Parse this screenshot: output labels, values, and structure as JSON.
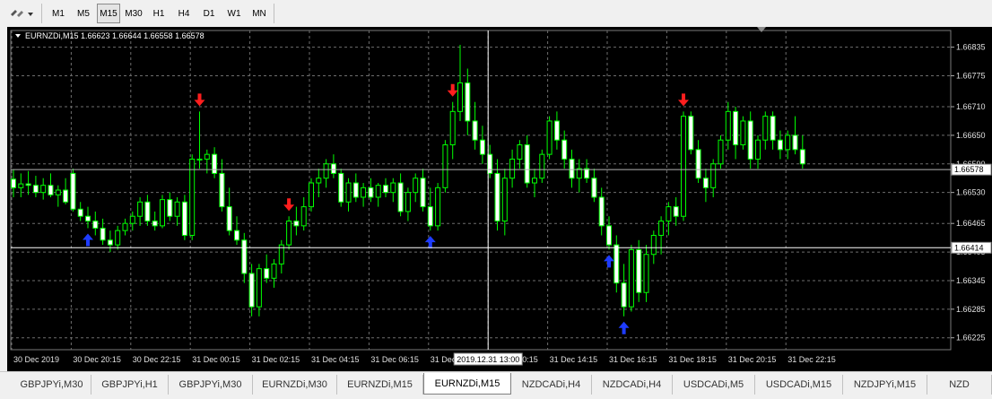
{
  "toolbar": {
    "timeframes": [
      {
        "label": "M1",
        "active": false
      },
      {
        "label": "M5",
        "active": false
      },
      {
        "label": "M15",
        "active": true
      },
      {
        "label": "M30",
        "active": false
      },
      {
        "label": "H1",
        "active": false
      },
      {
        "label": "H4",
        "active": false
      },
      {
        "label": "D1",
        "active": false
      },
      {
        "label": "W1",
        "active": false
      },
      {
        "label": "MN",
        "active": false
      }
    ]
  },
  "chart": {
    "header": "EURNZDi,M15  1.66623 1.66644 1.66558 1.66578",
    "current_price_label": "1.66578",
    "crosshair_price_label": "1.66414",
    "crosshair_time_label": "2019.12.31 13:00",
    "colors": {
      "background": "#000000",
      "up": "#00ff00",
      "down": "#00ff00",
      "body_up": "#000000",
      "body_down": "#ffffff",
      "grid": "#6e6e6e",
      "signal_up": "#1e3cff",
      "signal_down": "#ff1e1e"
    }
  },
  "chart_data": {
    "type": "candlestick",
    "y_ticks": [
      "1.66835",
      "1.66775",
      "1.66710",
      "1.66650",
      "1.66590",
      "1.66530",
      "1.66465",
      "1.66405",
      "1.66345",
      "1.66285",
      "1.66225"
    ],
    "ylim": [
      1.662,
      1.6687
    ],
    "x_ticks": [
      "30 Dec 2019",
      "30 Dec 20:15",
      "30 Dec 22:15",
      "31 Dec 00:15",
      "31 Dec 02:15",
      "31 Dec 04:15",
      "31 Dec 06:15",
      "31 Dec 08:15",
      "31 Dec 10:15",
      "31 Dec 14:15",
      "31 Dec 16:15",
      "31 Dec 18:15",
      "31 Dec 20:15",
      "31 Dec 22:15"
    ],
    "candles": [
      [
        1.66558,
        1.66578,
        1.6652,
        1.6654
      ],
      [
        1.6654,
        1.6657,
        1.6652,
        1.66548
      ],
      [
        1.66548,
        1.66575,
        1.66525,
        1.66545
      ],
      [
        1.66545,
        1.66565,
        1.6652,
        1.6653
      ],
      [
        1.6653,
        1.6656,
        1.66515,
        1.66545
      ],
      [
        1.66545,
        1.6657,
        1.6652,
        1.66525
      ],
      [
        1.66525,
        1.66545,
        1.665,
        1.66535
      ],
      [
        1.66535,
        1.6656,
        1.66505,
        1.6651
      ],
      [
        1.6657,
        1.6658,
        1.6649,
        1.66495
      ],
      [
        1.66495,
        1.6651,
        1.6647,
        1.6648
      ],
      [
        1.6648,
        1.665,
        1.66455,
        1.6647
      ],
      [
        1.6647,
        1.6649,
        1.6644,
        1.66455
      ],
      [
        1.66455,
        1.66475,
        1.6642,
        1.6643
      ],
      [
        1.6643,
        1.6645,
        1.66405,
        1.6642
      ],
      [
        1.6642,
        1.6646,
        1.6641,
        1.6645
      ],
      [
        1.6645,
        1.66475,
        1.6644,
        1.66465
      ],
      [
        1.66465,
        1.6649,
        1.6645,
        1.6648
      ],
      [
        1.6648,
        1.6652,
        1.6646,
        1.6651
      ],
      [
        1.6651,
        1.66525,
        1.6646,
        1.6647
      ],
      [
        1.6647,
        1.6649,
        1.6645,
        1.6646
      ],
      [
        1.6646,
        1.66525,
        1.66455,
        1.66515
      ],
      [
        1.66515,
        1.6653,
        1.6647,
        1.6648
      ],
      [
        1.6648,
        1.6652,
        1.6646,
        1.6651
      ],
      [
        1.6651,
        1.66525,
        1.6643,
        1.6644
      ],
      [
        1.6644,
        1.6661,
        1.6643,
        1.666
      ],
      [
        1.666,
        1.667,
        1.6658,
        1.666
      ],
      [
        1.666,
        1.6662,
        1.6657,
        1.6661
      ],
      [
        1.6661,
        1.66625,
        1.6656,
        1.6657
      ],
      [
        1.6657,
        1.666,
        1.6649,
        1.665
      ],
      [
        1.665,
        1.6654,
        1.6644,
        1.6645
      ],
      [
        1.6645,
        1.6648,
        1.6642,
        1.6643
      ],
      [
        1.6643,
        1.66445,
        1.6634,
        1.6636
      ],
      [
        1.6636,
        1.6638,
        1.6627,
        1.6629
      ],
      [
        1.6629,
        1.6638,
        1.6627,
        1.6637
      ],
      [
        1.6637,
        1.664,
        1.6634,
        1.6635
      ],
      [
        1.6635,
        1.6639,
        1.6633,
        1.6638
      ],
      [
        1.6638,
        1.6643,
        1.6636,
        1.6642
      ],
      [
        1.6642,
        1.6648,
        1.6641,
        1.6647
      ],
      [
        1.6647,
        1.665,
        1.6644,
        1.6646
      ],
      [
        1.6646,
        1.6652,
        1.6645,
        1.665
      ],
      [
        1.665,
        1.6656,
        1.6649,
        1.6655
      ],
      [
        1.6655,
        1.6658,
        1.6652,
        1.6656
      ],
      [
        1.6656,
        1.666,
        1.6654,
        1.6659
      ],
      [
        1.6659,
        1.6661,
        1.6656,
        1.6657
      ],
      [
        1.6657,
        1.6658,
        1.665,
        1.6651
      ],
      [
        1.6651,
        1.6656,
        1.6649,
        1.6655
      ],
      [
        1.6655,
        1.6657,
        1.6651,
        1.6652
      ],
      [
        1.6652,
        1.6655,
        1.665,
        1.6654
      ],
      [
        1.6654,
        1.6656,
        1.6651,
        1.6652
      ],
      [
        1.6652,
        1.6655,
        1.665,
        1.66545
      ],
      [
        1.66545,
        1.6656,
        1.6652,
        1.6653
      ],
      [
        1.6653,
        1.6656,
        1.6651,
        1.6655
      ],
      [
        1.6655,
        1.6657,
        1.6648,
        1.6649
      ],
      [
        1.6649,
        1.6654,
        1.6647,
        1.6653
      ],
      [
        1.6653,
        1.6657,
        1.6651,
        1.6656
      ],
      [
        1.6656,
        1.6658,
        1.6649,
        1.665
      ],
      [
        1.665,
        1.6654,
        1.6645,
        1.6646
      ],
      [
        1.6646,
        1.6655,
        1.6645,
        1.6654
      ],
      [
        1.6654,
        1.6664,
        1.6653,
        1.6663
      ],
      [
        1.6663,
        1.6672,
        1.666,
        1.667
      ],
      [
        1.667,
        1.6684,
        1.6668,
        1.6676
      ],
      [
        1.6676,
        1.6679,
        1.6665,
        1.6668
      ],
      [
        1.6668,
        1.6672,
        1.6662,
        1.6664
      ],
      [
        1.6664,
        1.6667,
        1.6659,
        1.6661
      ],
      [
        1.6661,
        1.6663,
        1.6656,
        1.6657
      ],
      [
        1.6657,
        1.666,
        1.6645,
        1.6647
      ],
      [
        1.6647,
        1.6658,
        1.6644,
        1.6656
      ],
      [
        1.6656,
        1.6662,
        1.6654,
        1.666
      ],
      [
        1.666,
        1.6664,
        1.6658,
        1.6663
      ],
      [
        1.6663,
        1.6665,
        1.6654,
        1.6655
      ],
      [
        1.6655,
        1.6658,
        1.6652,
        1.6656
      ],
      [
        1.6656,
        1.6662,
        1.6655,
        1.6661
      ],
      [
        1.6661,
        1.6669,
        1.666,
        1.6668
      ],
      [
        1.6668,
        1.667,
        1.6662,
        1.6664
      ],
      [
        1.6664,
        1.6666,
        1.6658,
        1.666
      ],
      [
        1.666,
        1.6662,
        1.6654,
        1.6656
      ],
      [
        1.6656,
        1.666,
        1.6653,
        1.6658
      ],
      [
        1.6658,
        1.666,
        1.6655,
        1.6656
      ],
      [
        1.6656,
        1.6658,
        1.6651,
        1.6652
      ],
      [
        1.6652,
        1.6654,
        1.6644,
        1.6646
      ],
      [
        1.6646,
        1.6648,
        1.6641,
        1.6642
      ],
      [
        1.6642,
        1.6644,
        1.6632,
        1.6634
      ],
      [
        1.6634,
        1.6638,
        1.6627,
        1.6629
      ],
      [
        1.6629,
        1.6642,
        1.6628,
        1.6641
      ],
      [
        1.6641,
        1.6643,
        1.663,
        1.6632
      ],
      [
        1.6632,
        1.6642,
        1.663,
        1.664
      ],
      [
        1.664,
        1.6645,
        1.6638,
        1.6644
      ],
      [
        1.6644,
        1.6648,
        1.664,
        1.6647
      ],
      [
        1.6647,
        1.6651,
        1.6644,
        1.665
      ],
      [
        1.665,
        1.6652,
        1.6646,
        1.6648
      ],
      [
        1.6648,
        1.667,
        1.6647,
        1.6669
      ],
      [
        1.6669,
        1.667,
        1.6661,
        1.6662
      ],
      [
        1.6662,
        1.6664,
        1.6655,
        1.6656
      ],
      [
        1.6656,
        1.6658,
        1.6651,
        1.6654
      ],
      [
        1.6654,
        1.666,
        1.6652,
        1.6659
      ],
      [
        1.6659,
        1.6665,
        1.6658,
        1.6664
      ],
      [
        1.6664,
        1.6672,
        1.6662,
        1.667
      ],
      [
        1.667,
        1.6671,
        1.666,
        1.6663
      ],
      [
        1.6663,
        1.6669,
        1.6662,
        1.6668
      ],
      [
        1.6668,
        1.667,
        1.6658,
        1.666
      ],
      [
        1.666,
        1.6665,
        1.6658,
        1.6664
      ],
      [
        1.6664,
        1.667,
        1.6662,
        1.6669
      ],
      [
        1.6669,
        1.667,
        1.6662,
        1.6664
      ],
      [
        1.6664,
        1.6666,
        1.666,
        1.6662
      ],
      [
        1.6662,
        1.6666,
        1.666,
        1.6665
      ],
      [
        1.6665,
        1.6669,
        1.6661,
        1.6662
      ],
      [
        1.6662,
        1.6665,
        1.6658,
        1.6659
      ]
    ],
    "signals": [
      {
        "index": 10,
        "dir": "up"
      },
      {
        "index": 25,
        "dir": "down"
      },
      {
        "index": 37,
        "dir": "down"
      },
      {
        "index": 56,
        "dir": "up"
      },
      {
        "index": 59,
        "dir": "down"
      },
      {
        "index": 80,
        "dir": "up"
      },
      {
        "index": 82,
        "dir": "up"
      },
      {
        "index": 90,
        "dir": "down"
      }
    ],
    "current_price": 1.66578,
    "crosshair_price": 1.66414,
    "crosshair_index": 64
  },
  "tabs": [
    {
      "label": "GBPJPYi,M30",
      "active": false
    },
    {
      "label": "GBPJPYi,H1",
      "active": false
    },
    {
      "label": "GBPJPYi,M30",
      "active": false
    },
    {
      "label": "EURNZDi,M30",
      "active": false
    },
    {
      "label": "EURNZDi,M15",
      "active": false
    },
    {
      "label": "EURNZDi,M15",
      "active": true
    },
    {
      "label": "NZDCADi,H4",
      "active": false
    },
    {
      "label": "NZDCADi,H4",
      "active": false
    },
    {
      "label": "USDCADi,M5",
      "active": false
    },
    {
      "label": "USDCADi,M15",
      "active": false
    },
    {
      "label": "NZDJPYi,M15",
      "active": false
    },
    {
      "label": "NZD",
      "active": false
    }
  ]
}
